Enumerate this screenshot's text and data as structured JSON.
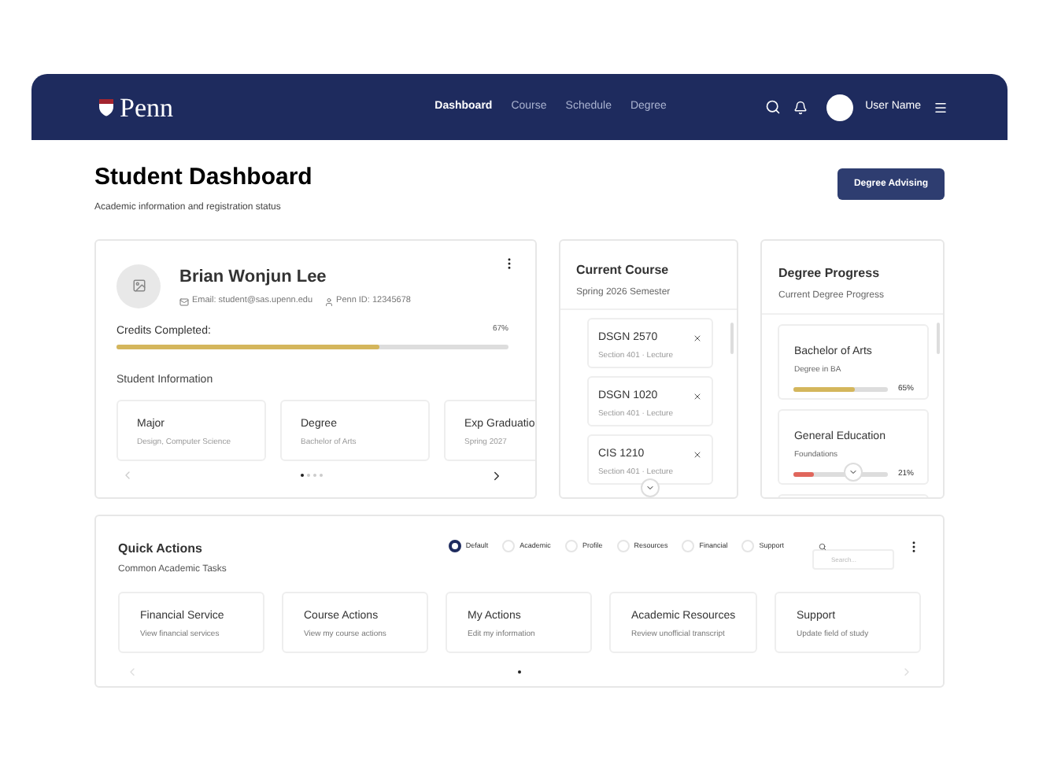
{
  "nav": {
    "logo": "Penn",
    "links": [
      {
        "label": "Dashboard",
        "selected": true
      },
      {
        "label": "Course",
        "selected": false
      },
      {
        "label": "Schedule",
        "selected": false
      },
      {
        "label": "Degree",
        "selected": false
      }
    ],
    "user_name": "User Name"
  },
  "header": {
    "title": "Student Dashboard",
    "subtitle": "Academic information and registration status",
    "button": "Degree Advising"
  },
  "student": {
    "name": "Brian Wonjun Lee",
    "email": "Email: student@sas.upenn.edu",
    "penn_id": "Penn ID: 12345678",
    "credits_label": "Credits Completed:",
    "credits_reading": "67%",
    "level": 0.67,
    "section": "Student Information",
    "info_cards": [
      {
        "title": "Major",
        "value": "Design, Computer Science"
      },
      {
        "title": "Degree",
        "value": "Bachelor of Arts"
      },
      {
        "title": "Exp Graduatio",
        "value": "Spring 2027"
      }
    ],
    "dots": [
      {
        "selected": true
      },
      {
        "selected": false
      },
      {
        "selected": false
      },
      {
        "selected": false
      }
    ]
  },
  "current_course": {
    "title": "Current Course",
    "subtitle": "Spring 2026 Semester",
    "courses": [
      {
        "code": "DSGN 2570",
        "section": "Section 401 · Lecture"
      },
      {
        "code": "DSGN 1020",
        "section": "Section 401 · Lecture"
      },
      {
        "code": "CIS 1210",
        "section": "Section 401 · Lecture"
      }
    ]
  },
  "degree_progress": {
    "title": "Degree Progress",
    "subtitle": "Current Degree Progress",
    "items": [
      {
        "title": "Bachelor of Arts",
        "subtitle": "Degree in BA",
        "level": 0.65,
        "reading": "65%",
        "color": "#d4b65c"
      },
      {
        "title": "General Education",
        "subtitle": "Foundations",
        "level": 0.21,
        "reading": "21%",
        "color": "#e0665c"
      }
    ]
  },
  "quick_actions": {
    "title": "Quick Actions",
    "subtitle": "Common Academic Tasks",
    "filters": [
      {
        "label": "Default",
        "selected": true
      },
      {
        "label": "Academic",
        "selected": false
      },
      {
        "label": "Profile",
        "selected": false
      },
      {
        "label": "Resources",
        "selected": false
      },
      {
        "label": "Financial",
        "selected": false
      },
      {
        "label": "Support",
        "selected": false
      }
    ],
    "search_placeholder": "Search...",
    "actions": [
      {
        "title": "Financial Service",
        "subtitle": "View financial services"
      },
      {
        "title": "Course Actions",
        "subtitle": "View my course actions"
      },
      {
        "title": "My Actions",
        "subtitle": "Edit my information"
      },
      {
        "title": "Academic Resources",
        "subtitle": "Review unofficial transcript"
      },
      {
        "title": "Support",
        "subtitle": "Update field of study"
      }
    ],
    "dots": [
      {
        "selected": true
      }
    ]
  }
}
